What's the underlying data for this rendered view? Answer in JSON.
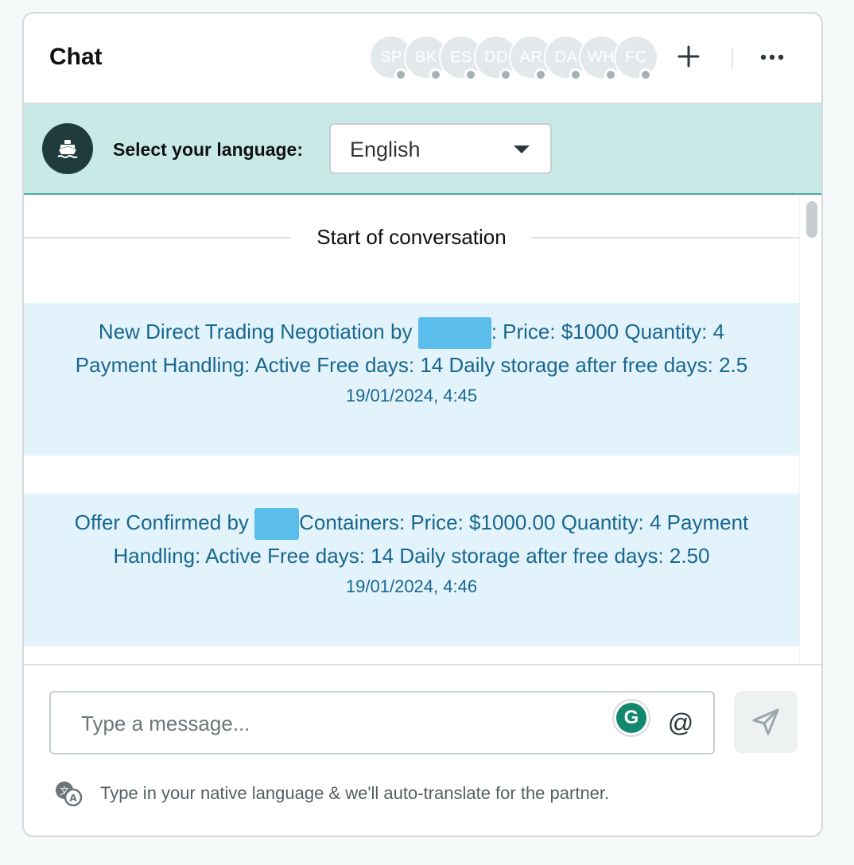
{
  "header": {
    "title": "Chat",
    "participants": [
      "SP",
      "BK",
      "ES",
      "DD",
      "AR",
      "DA",
      "WH",
      "FC"
    ],
    "add_icon": "plus-icon",
    "more_icon": "more-horizontal-icon"
  },
  "language": {
    "label": "Select your language:",
    "selected": "English",
    "badge_icon": "ship-icon"
  },
  "conversation": {
    "start_label": "Start of conversation",
    "messages": [
      {
        "prefix": "New Direct Trading Negotiation by",
        "text": ": Price: $1000 Quantity: 4 Payment Handling: Active Free days: 14 Daily storage after free days: 2.5",
        "timestamp": "19/01/2024, 4:45"
      },
      {
        "prefix": "Offer Confirmed by",
        "text": "Containers: Price: $1000.00 Quantity: 4 Payment Handling: Active Free days: 14 Daily storage after free days: 2.50",
        "timestamp": "19/01/2024, 4:46"
      }
    ]
  },
  "composer": {
    "placeholder": "Type a message...",
    "value": "",
    "grammarly_letter": "G",
    "mention_symbol": "@",
    "send_icon": "send-icon",
    "hint": "Type in your native language & we'll auto-translate for the partner.",
    "hint_icon": "translate-icon"
  },
  "colors": {
    "language_bar": "#c8e9e6",
    "message_bg": "#e2f3fc",
    "message_text": "#19678f",
    "redaction": "#5bbdeb"
  }
}
